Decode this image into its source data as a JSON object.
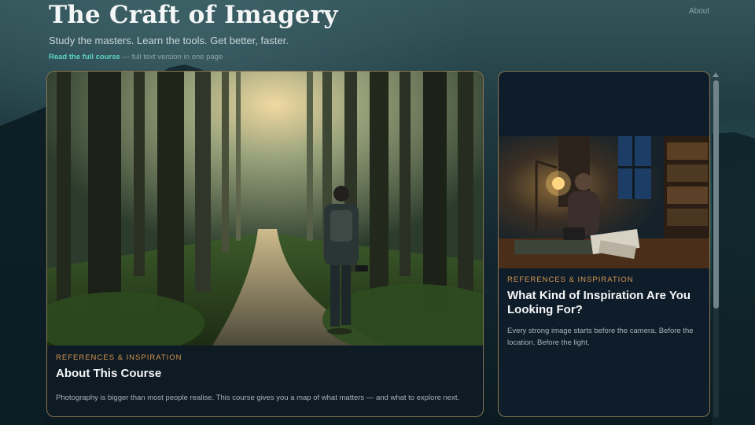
{
  "header": {
    "site_title": "The Craft of Imagery",
    "tagline": "Study the masters. Learn the tools. Get better, faster.",
    "course_link": "Read the full course",
    "course_link_note": " — full text version in one page",
    "nav_about": "About"
  },
  "cards": [
    {
      "image_icon": "forest-photo",
      "category": "REFERENCES & INSPIRATION",
      "title": "About This Course",
      "excerpt": "Photography is bigger than most people realise. This course gives you a map of what matters — and what to explore next."
    },
    {
      "image_icon": "desk-lamp-photo",
      "category": "REFERENCES & INSPIRATION",
      "title": "What Kind of Inspiration Are You Looking For?",
      "excerpt": "Every strong image starts before the camera. Before the location. Before the light."
    }
  ],
  "colors": {
    "accent_teal": "#5fd3c4",
    "category_orange": "#d7964f",
    "card_border": "#b4965f"
  }
}
